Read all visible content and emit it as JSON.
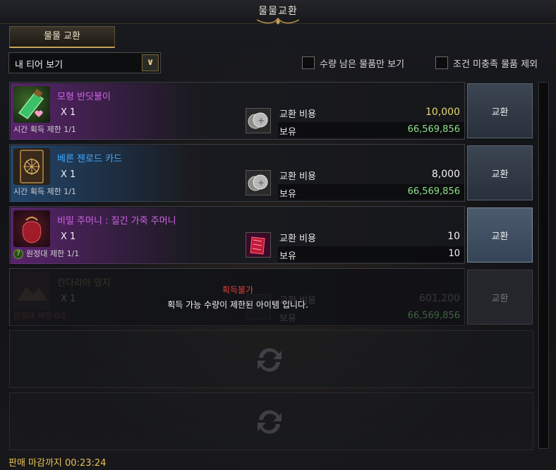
{
  "window": {
    "title": "물물교환"
  },
  "tabs": [
    {
      "label": "물물 교환"
    }
  ],
  "filter": {
    "dropdown_value": "내 티어 보기",
    "checkbox_remaining": "수량 남은 물품만 보기",
    "checkbox_exclude": "조건 미충족 물품 제외"
  },
  "items": [
    {
      "name": "모형 반딧불이",
      "name_color": "#d064e6",
      "qty": "X 1",
      "limit": "시간 획득 제한 1/1",
      "cost_label": "교환 비용",
      "cost": "10,000",
      "cost_color": "#e6d770",
      "own_label": "보유",
      "own": "66,569,856",
      "own_color": "#8fe08a",
      "button": "교환",
      "icon": "firefly-bottle-icon"
    },
    {
      "name": "베른 젠로드 카드",
      "name_color": "#3fa9ff",
      "qty": "X 1",
      "limit": "시간 획득 제한 1/1",
      "cost_label": "교환 비용",
      "cost": "8,000",
      "cost_color": "#f2f2f2",
      "own_label": "보유",
      "own": "66,569,856",
      "own_color": "#8fe08a",
      "button": "교환",
      "icon": "card-icon"
    },
    {
      "name": "비밀 주머니 : 질긴 가죽 주머니",
      "name_color": "#d064e6",
      "qty": "X 1",
      "limit_badge": "?",
      "limit": "원정대 제한 1/1",
      "cost_label": "교환 비용",
      "cost": "10",
      "cost_color": "#f2f2f2",
      "own_label": "보유",
      "own": "10",
      "own_color": "#f2f2f2",
      "button": "교환",
      "icon": "pouch-icon"
    },
    {
      "name": "칸다리아 영지",
      "name_color": "#e0b070",
      "qty": "X 1",
      "limit": "원정대 제한 0/1",
      "cost_label": "교환 비용",
      "cost": "601,200",
      "cost_color": "#f2f2f2",
      "own_label": "보유",
      "own": "66,569,856",
      "own_color": "#8fe08a",
      "button": "교환",
      "icon": "estate-icon",
      "unavailable_title": "획득불가",
      "unavailable_msg": "획득 가능 수량이 제한된 아이템 입니다."
    }
  ],
  "footer": {
    "deadline": "판매 마감까지 00:23:24"
  }
}
